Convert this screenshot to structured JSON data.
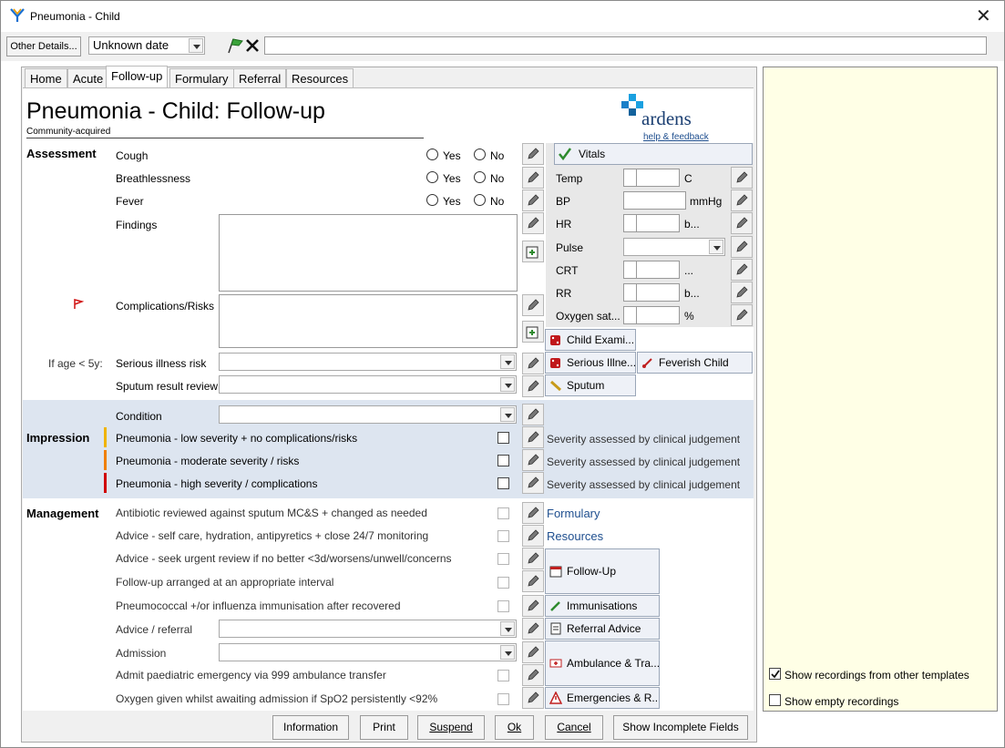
{
  "window": {
    "title": "Pneumonia - Child"
  },
  "toolbar": {
    "other_details": "Other Details...",
    "date_value": "Unknown date",
    "text_value": ""
  },
  "tabs": [
    "Home",
    "Acute",
    "Follow-up",
    "Formulary",
    "Referral",
    "Resources"
  ],
  "header": {
    "title": "Pneumonia - Child: Follow-up",
    "subtitle": "Community-acquired",
    "brand": "ardens",
    "help_link": "help & feedback"
  },
  "assessment": {
    "section": "Assessment",
    "cough": "Cough",
    "breath": "Breathlessness",
    "fever": "Fever",
    "yes": "Yes",
    "no": "No",
    "findings": "Findings",
    "complications": "Complications/Risks",
    "age_note": "If age < 5y:",
    "serious": "Serious illness risk",
    "sputum": "Sputum result review"
  },
  "vitals": {
    "header": "Vitals",
    "rows": [
      {
        "label": "Temp",
        "unit": "C"
      },
      {
        "label": "BP",
        "unit": "mmHg"
      },
      {
        "label": "HR",
        "unit": "b..."
      },
      {
        "label": "Pulse",
        "unit": ""
      },
      {
        "label": "CRT",
        "unit": "..."
      },
      {
        "label": "RR",
        "unit": "b..."
      },
      {
        "label": "Oxygen sat...",
        "unit": "%"
      }
    ]
  },
  "side_buttons": {
    "child_exam": "Child Exami...",
    "serious_illness": "Serious Illne...",
    "feverish": "Feverish Child",
    "sputum": "Sputum"
  },
  "impression": {
    "section": "Impression",
    "condition": "Condition",
    "items": [
      {
        "label": "Pneumonia - low severity + no complications/risks",
        "note": "Severity assessed by clinical judgement",
        "color": "#f0b400"
      },
      {
        "label": "Pneumonia - moderate severity / risks",
        "note": "Severity assessed by clinical judgement",
        "color": "#f08000"
      },
      {
        "label": "Pneumonia - high severity / complications",
        "note": "Severity assessed by clinical judgement",
        "color": "#d00000"
      }
    ]
  },
  "management": {
    "section": "Management",
    "items": [
      "Antibiotic reviewed against sputum MC&S + changed as needed",
      "Advice - self care, hydration, antipyretics + close 24/7 monitoring",
      "Advice - seek urgent review if no better <3d/worsens/unwell/concerns",
      "Follow-up arranged at an appropriate interval",
      "Pneumococcal +/or influenza immunisation after recovered"
    ],
    "advice_referral": "Advice / referral",
    "admission": "Admission",
    "admit_items": [
      "Admit paediatric emergency via 999 ambulance transfer",
      "Oxygen given whilst awaiting admission if SpO2 persistently <92%"
    ],
    "links": {
      "formulary": "Formulary",
      "resources": "Resources"
    },
    "buttons": {
      "followup": "Follow-Up",
      "immunisations": "Immunisations",
      "referral": "Referral Advice",
      "ambulance": "Ambulance & Tra...",
      "emergencies": "Emergencies & R..."
    }
  },
  "right_panel": {
    "show_other": "Show recordings from other templates",
    "show_empty": "Show empty recordings"
  },
  "bottom": {
    "information": "Information",
    "print": "Print",
    "suspend": "Suspend",
    "ok": "Ok",
    "cancel": "Cancel",
    "incomplete": "Show Incomplete Fields"
  },
  "colors": {
    "impression_bg": "#dde5f0",
    "tick_green": "#2e8b2e",
    "accent": "#1f4f8f"
  }
}
